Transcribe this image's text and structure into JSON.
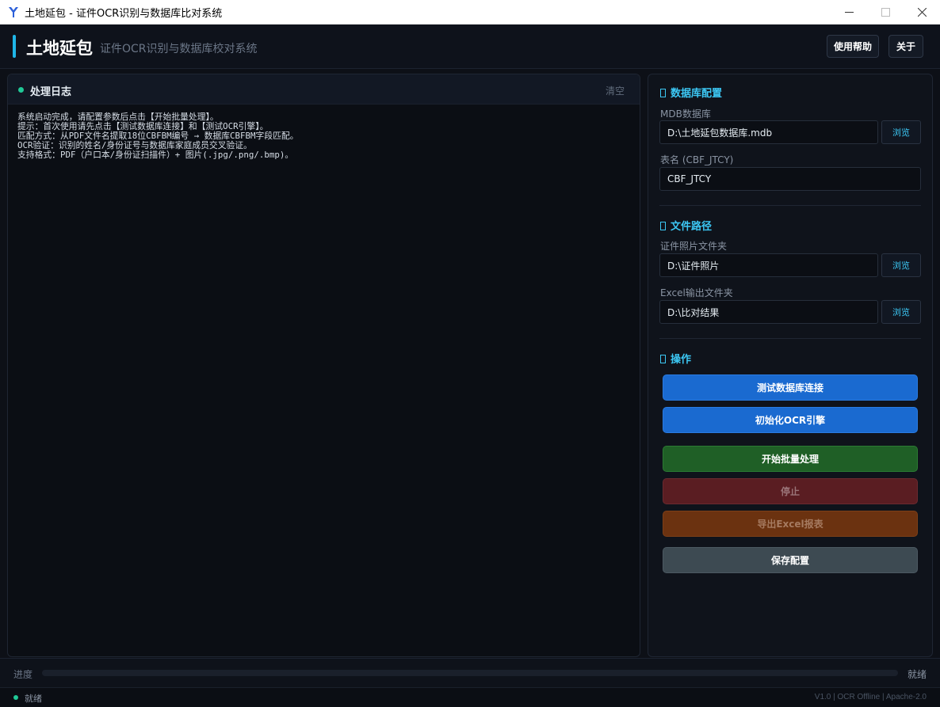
{
  "window": {
    "title": "土地延包 - 证件OCR识别与数据库比对系统",
    "minimize_icon": "minimize-icon",
    "maximize_icon": "maximize-icon",
    "close_icon": "close-icon"
  },
  "header": {
    "app_name": "土地延包",
    "subtitle": "证件OCR识别与数据库校对系统",
    "help_label": "使用帮助",
    "about_label": "关于",
    "accent_color": "#1fb6e8"
  },
  "log": {
    "title": "处理日志",
    "clear_label": "清空",
    "lines": [
      "系统启动完成，请配置参数后点击【开始批量处理】。",
      "提示：首次使用请先点击【测试数据库连接】和【测试OCR引擎】。",
      "匹配方式：从PDF文件名提取18位CBFBM编号 → 数据库CBFBM字段匹配。",
      "OCR验证：识别的姓名/身份证号与数据库家庭成员交叉验证。",
      "支持格式：PDF（户口本/身份证扫描件）+ 图片(.jpg/.png/.bmp)。"
    ]
  },
  "config": {
    "db_section": {
      "title": "数据库配置",
      "mdb_label": "MDB数据库",
      "mdb_value": "D:\\土地延包数据库.mdb",
      "table_label": "表名 (CBF_JTCY)",
      "table_value": "CBF_JTCY",
      "browse_label": "浏览"
    },
    "path_section": {
      "title": "文件路径",
      "photo_label": "证件照片文件夹",
      "photo_value": "D:\\证件照片",
      "excel_label": "Excel输出文件夹",
      "excel_value": "D:\\比对结果",
      "browse_label": "浏览"
    },
    "ops_section": {
      "title": "操作",
      "test_db": "测试数据库连接",
      "init_ocr": "初始化OCR引擎",
      "start_batch": "开始批量处理",
      "stop": "停止",
      "export_excel": "导出Excel报表",
      "save_config": "保存配置"
    }
  },
  "progress": {
    "label": "进度",
    "value": 0,
    "status": "就绪"
  },
  "statusbar": {
    "status": "就绪",
    "right_text": "V1.0 | OCR Offline | Apache-2.0"
  }
}
